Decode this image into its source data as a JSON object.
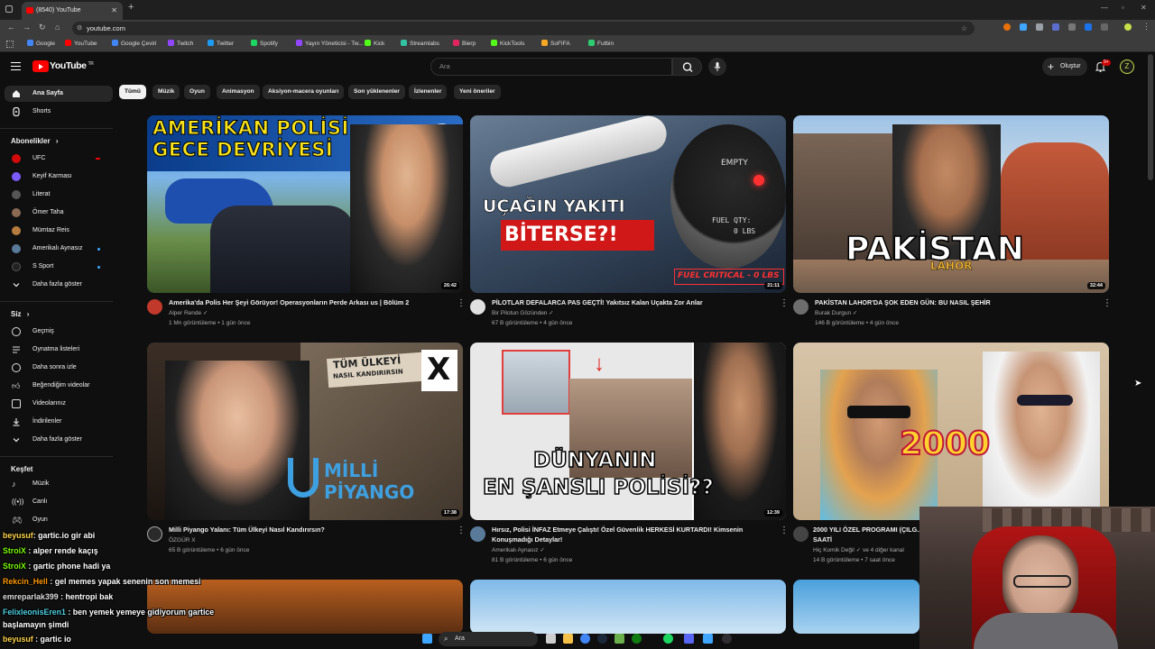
{
  "browser": {
    "tab_title": "(8540) YouTube",
    "new_tab": "+",
    "url": "youtube.com",
    "bookmarks": [
      {
        "label": "Google",
        "color": "#4285f4"
      },
      {
        "label": "YouTube",
        "color": "#ff0000"
      },
      {
        "label": "Google Çeviri",
        "color": "#4285f4"
      },
      {
        "label": "Twitch",
        "color": "#9146ff"
      },
      {
        "label": "Twitter",
        "color": "#1d9bf0"
      },
      {
        "label": "Spotify",
        "color": "#1ed760"
      },
      {
        "label": "Yayın Yöneticisi - Tw...",
        "color": "#9146ff"
      },
      {
        "label": "Kick",
        "color": "#53fc18"
      },
      {
        "label": "Streamlabs",
        "color": "#31c3a2"
      },
      {
        "label": "Bierp",
        "color": "#e0245e"
      },
      {
        "label": "KickTools",
        "color": "#53fc18"
      },
      {
        "label": "SoFIFA",
        "color": "#f5a623"
      },
      {
        "label": "Futbin",
        "color": "#2ecc71"
      }
    ]
  },
  "header": {
    "logo_text": "YouTube",
    "logo_sup": "TR",
    "search_placeholder": "Ara",
    "create_label": "Oluştur",
    "notif_badge": "9+",
    "avatar_letter": "Z"
  },
  "sidebar": {
    "main": [
      {
        "label": "Ana Sayfa",
        "icon": "home-icon"
      },
      {
        "label": "Shorts",
        "icon": "shorts-icon"
      }
    ],
    "subs_title": "Abonelikler",
    "subs_chevron": "›",
    "subs": [
      {
        "label": "UFC",
        "color": "#d20a0a",
        "dot": "red"
      },
      {
        "label": "Keyif Karması",
        "color": "#7a5cff",
        "dot": "none"
      },
      {
        "label": "Literat",
        "color": "#555555",
        "dot": "none"
      },
      {
        "label": "Ömer Taha",
        "color": "#8a6a55",
        "dot": "none"
      },
      {
        "label": "Mümtaz Reis",
        "color": "#b57b3f",
        "dot": "none"
      },
      {
        "label": "Amerikalı Aynasız",
        "color": "#5a7a9a",
        "dot": "blue"
      },
      {
        "label": "S Sport",
        "color": "#222222",
        "dot": "blue"
      },
      {
        "label": "Daha fazla göster",
        "color": "",
        "dot": "none"
      }
    ],
    "you_title": "Siz",
    "you_chevron": "›",
    "you": [
      {
        "label": "Geçmiş",
        "icon": "history-icon"
      },
      {
        "label": "Oynatma listeleri",
        "icon": "playlists-icon"
      },
      {
        "label": "Daha sonra izle",
        "icon": "watch-later-icon"
      },
      {
        "label": "Beğendiğim videolar",
        "icon": "like-icon"
      },
      {
        "label": "Videolarınız",
        "icon": "your-videos-icon"
      },
      {
        "label": "İndirilenler",
        "icon": "download-icon"
      },
      {
        "label": "Daha fazla göster",
        "icon": "chevron-down-icon"
      }
    ],
    "explore_title": "Keşfet",
    "explore": [
      {
        "label": "Müzik",
        "icon": "music-icon"
      },
      {
        "label": "Canlı",
        "icon": "live-icon"
      },
      {
        "label": "Oyun",
        "icon": "gaming-icon"
      }
    ]
  },
  "chips": [
    "Tümü",
    "Müzik",
    "Oyun",
    "Animasyon",
    "Aksiyon-macera oyunları",
    "Son yüklenenler",
    "İzlenenler",
    "Yeni öneriler"
  ],
  "videos": [
    {
      "title": "Amerika'da Polis Her Şeyi Görüyor! Operasyonların Perde Arkası us | Bölüm 2",
      "channel": "Alper Rende",
      "meta": "1 Mn görüntüleme • 1 gün önce",
      "duration": "26:42",
      "avatar_color": "#c0392b",
      "thumb_line1": "AMERİKAN POLİSİ",
      "thumb_line2": "GECE DEVRİYESİ",
      "thumb_num": "2"
    },
    {
      "title": "PİLOTLAR DEFALARCA PAS GEÇTİ! Yakıtsız Kalan Uçakta Zor Anlar",
      "channel": "Bir Pilotun Gözünden",
      "meta": "67 B görüntüleme • 4 gün önce",
      "duration": "21:11",
      "avatar_color": "#e0e0e0",
      "thumb_line1": "UÇAĞIN YAKITI",
      "thumb_line2": "BİTERSE?!",
      "thumb_gauge1": "EMPTY",
      "thumb_gauge2": "FUEL QTY:",
      "thumb_gauge3": "0 LBS",
      "thumb_warn": "FUEL CRITICAL - 0 LBS"
    },
    {
      "title": "PAKİSTAN LAHOR'DA ŞOK EDEN GÜN: BU NASIL ŞEHİR",
      "channel": "Burak Durgun",
      "meta": "146 B görüntüleme • 4 gün önce",
      "duration": "32:44",
      "avatar_color": "#6d6d6d",
      "thumb_line1": "PAKİSTAN",
      "thumb_line2": "LAHOR"
    },
    {
      "title": "Milli Piyango Yalanı: Tüm Ülkeyi Nasıl Kandırırsın?",
      "channel": "ÖZGÜR X",
      "meta": "65 B görüntüleme • 6 gün önce",
      "duration": "17:38",
      "avatar_color": "#2a2a2a",
      "thumb_line1": "TÜM ÜLKEYİ",
      "thumb_line2": "NASIL KANDIRIRSIN",
      "thumb_line3": "MİLLİ",
      "thumb_line4": "PİYANGO"
    },
    {
      "title": "Hırsız, Polisi İNFAZ Etmeye Çalıştı! Özel Güvenlik HERKESİ KURTARDI! Kimsenin Konuşmadığı Detaylar!",
      "channel": "Amerikalı Aynasız",
      "meta": "81 B görüntüleme • 6 gün önce",
      "duration": "12:39",
      "avatar_color": "#5a7a9a",
      "thumb_line1": "DÜNYANIN",
      "thumb_line2": "EN ŞANSLI POLİSİ??"
    },
    {
      "title": "2000 YILI ÖZEL PROGRAMI (ÇILG... SAATİ",
      "channel": "Hiç Komik Değil",
      "channel_extra": "ve 4 diğer kanal",
      "meta": "14 B görüntüleme • 7 saat önce",
      "duration": "",
      "avatar_color": "#444444",
      "thumb_line1": "2000"
    }
  ],
  "chat": [
    {
      "user": "beyusuf",
      "user_color": "#ffd54a",
      "msg": ": gartic.io gir abi"
    },
    {
      "user": "StroiX",
      "user_color": "#7cfc00",
      "msg": " : alper rende kaçış"
    },
    {
      "user": "StroiX",
      "user_color": "#7cfc00",
      "msg": " : gartic phone hadi ya"
    },
    {
      "user": "Rekcin_Hell",
      "user_color": "#ff9800",
      "msg": " : gel memes yapak senenin son memesi"
    },
    {
      "user": "emreparlak399",
      "user_color": "#dddddd",
      "msg": " : hentropi bak"
    },
    {
      "user": "FelixleonisEren1",
      "user_color": "#4dd0e1",
      "msg": " : ben yemek yemeye gidiyorum gartice"
    },
    {
      "user": "",
      "user_color": "#ffffff",
      "msg": "başlamayın şimdi"
    },
    {
      "user": "beyusuf",
      "user_color": "#ffd54a",
      "msg": " : gartic io"
    }
  ],
  "taskbar": {
    "search_label": "Ara"
  }
}
